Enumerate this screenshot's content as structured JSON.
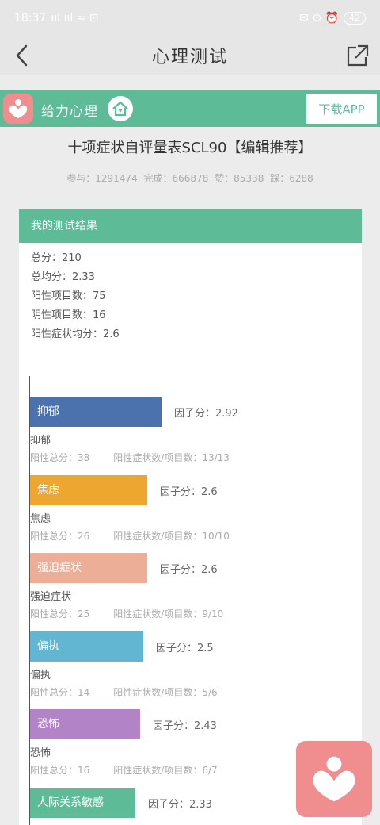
{
  "status_bar": {
    "time": "18:37",
    "left_icons": "ııl ııl ≈ ⊡",
    "right_icons": "✉ ⊙ ⏰",
    "battery": "42"
  },
  "nav": {
    "title": "心理测试"
  },
  "banner": {
    "brand": "给力心理",
    "download": "下载APP"
  },
  "test": {
    "title": "十项症状自评量表SCL90【编辑推荐】",
    "stats": [
      "参与：1291474",
      "完成：666878",
      "赞：85338",
      "踩：6288"
    ]
  },
  "result": {
    "header": "我的测试结果",
    "summary": [
      "总分：210",
      "总均分：2.33",
      "阳性项目数：75",
      "阴性项目数：16",
      "阳性症状均分：2.6"
    ]
  },
  "chart_data": {
    "type": "bar",
    "orientation": "horizontal",
    "categories": [
      "抑郁",
      "焦虑",
      "强迫症状",
      "偏执",
      "恐怖",
      "人际关系敏感"
    ],
    "values": [
      2.92,
      2.6,
      2.6,
      2.5,
      2.43,
      2.33
    ],
    "colors": [
      "#4b72ad",
      "#eda731",
      "#ecae96",
      "#63b6d2",
      "#b383c8",
      "#5dbb98"
    ]
  },
  "factors": [
    {
      "name": "抑郁",
      "score": "因子分：2.92",
      "positive_total": "阳性总分：38",
      "positive_ratio": "阳性症状数/项目数：13/13"
    },
    {
      "name": "焦虑",
      "score": "因子分：2.6",
      "positive_total": "阳性总分：26",
      "positive_ratio": "阳性症状数/项目数：10/10"
    },
    {
      "name": "强迫症状",
      "score": "因子分：2.6",
      "positive_total": "阳性总分：25",
      "positive_ratio": "阳性症状数/项目数：9/10"
    },
    {
      "name": "偏执",
      "score": "因子分：2.5",
      "positive_total": "阳性总分：14",
      "positive_ratio": "阳性症状数/项目数：5/6"
    },
    {
      "name": "恐怖",
      "score": "因子分：2.43",
      "positive_total": "阳性总分：16",
      "positive_ratio": "阳性症状数/项目数：6/7"
    },
    {
      "name": "人际关系敏感",
      "score": "因子分：2.33"
    }
  ]
}
